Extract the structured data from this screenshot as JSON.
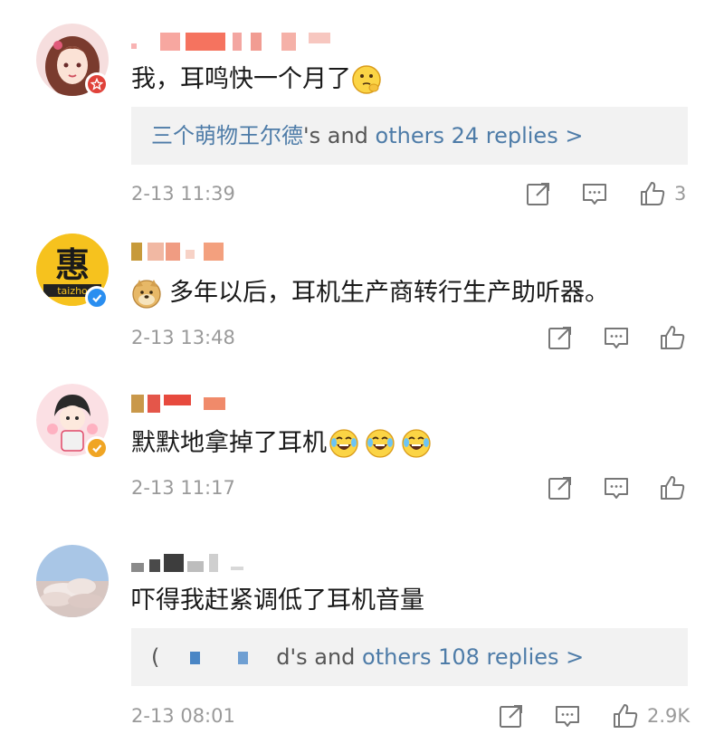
{
  "comments": [
    {
      "text": "我，耳鸣快一个月了",
      "emoji": "thinking-face-emoji",
      "replies": {
        "prefix_name": "三个萌物王尔德",
        "suffix": "'s and ",
        "more": "others 24 replies >"
      },
      "time": "2-13 11:39",
      "likes": "3",
      "badge_color": "#e0423a"
    },
    {
      "text": "多年以后，耳机生产商转行生产助听器。",
      "emoji": "doge-emoji",
      "avatar_char": "惠",
      "avatar_sub": "taizho",
      "time": "2-13 13:48",
      "badge_color": "#2a8ef0"
    },
    {
      "text": "默默地拿掉了耳机",
      "emoji": "laughing-tears-emoji",
      "time": "2-13 11:17",
      "badge_color": "#f0a524"
    },
    {
      "text": "吓得我赶紧调低了耳机音量",
      "replies": {
        "prefix_name": "d",
        "suffix": "'s and ",
        "more": "others 108 replies >"
      },
      "time": "2-13 08:01",
      "likes": "2.9K"
    }
  ],
  "colors": {
    "link": "#4e7ca8",
    "meta": "#9a9a9a",
    "reply_bg": "#f2f2f2"
  },
  "icons": [
    "repost-icon",
    "comment-icon",
    "like-icon"
  ]
}
